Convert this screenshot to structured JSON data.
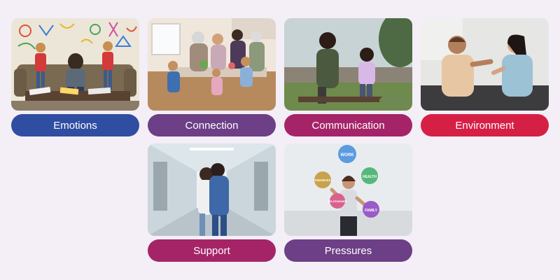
{
  "cards": [
    {
      "label": "Emotions",
      "color": "#2f4ea1",
      "image": "family-stress-photo"
    },
    {
      "label": "Connection",
      "color": "#6d3f86",
      "image": "family-kitchen-photo"
    },
    {
      "label": "Communication",
      "color": "#a52468",
      "image": "parent-child-talk-photo"
    },
    {
      "label": "Environment",
      "color": "#d61f45",
      "image": "couple-argument-photo"
    },
    {
      "label": "Support",
      "color": "#a52468",
      "image": "hospital-hug-photo"
    },
    {
      "label": "Pressures",
      "color": "#6d3f86",
      "image": "juggling-pressures-photo",
      "bubbles": [
        "WORK",
        "FINANCES",
        "HEALTH",
        "RELATIONSHIPS",
        "FAMILY"
      ]
    }
  ]
}
